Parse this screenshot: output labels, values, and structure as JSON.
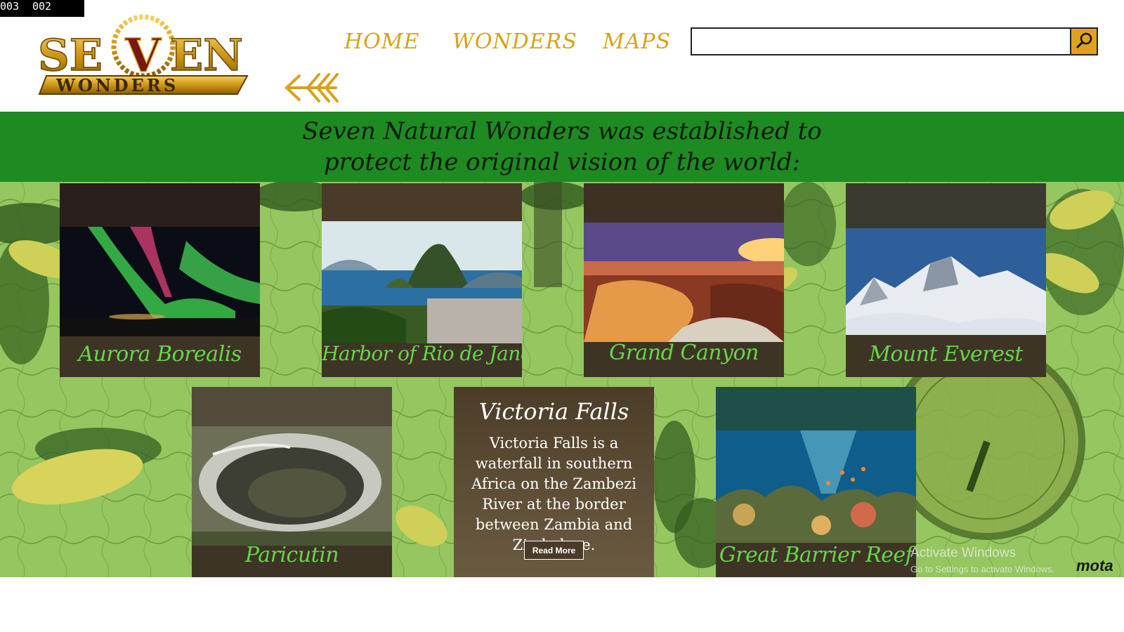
{
  "counter": {
    "left": "003",
    "right": "002"
  },
  "logo": {
    "line1_a": "SE",
    "line1_v": "V",
    "line1_b": "EN",
    "line2": "WONDERS"
  },
  "nav": {
    "home": "HOME",
    "wonders": "WONDERS",
    "maps": "MAPS"
  },
  "search": {
    "value": "",
    "placeholder": ""
  },
  "banner": {
    "text": "Seven Natural Wonders was established to protect the original vision of the world:"
  },
  "cards": [
    {
      "name": "Aurora Borealis"
    },
    {
      "name": "Harbor of Rio de Janeiro"
    },
    {
      "name": "Grand Canyon"
    },
    {
      "name": "Mount Everest"
    },
    {
      "name": "Paricutin"
    },
    {
      "name": "Victoria Falls",
      "description": "Victoria Falls is a waterfall in southern Africa on the Zambezi River at the border between Zambia and Zimbabwe.",
      "button": "Read More"
    },
    {
      "name": "Great Barrier Reef"
    }
  ],
  "watermark": {
    "title": "Activate Windows",
    "subtitle": "Go to Settings to activate Windows.",
    "brand": "mota"
  },
  "colors": {
    "gold": "#d9a21b",
    "banner_green": "#1e8a22",
    "caption_green": "#66d64a",
    "card_brown": "#3d3426"
  },
  "icons": {
    "search": "magnifier-icon",
    "back": "double-arrow-left-icon"
  }
}
